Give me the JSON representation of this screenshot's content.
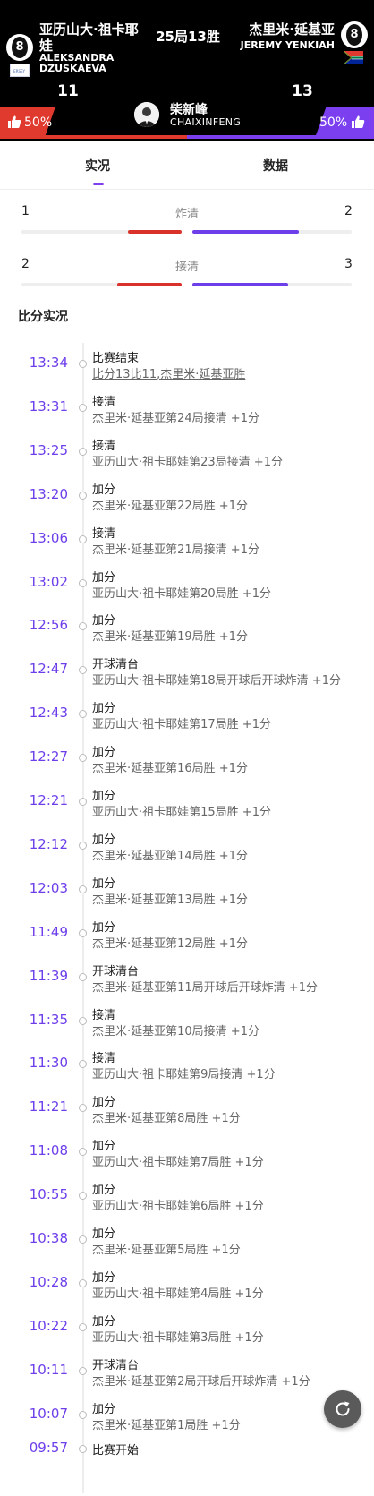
{
  "header": {
    "player_left": {
      "name_cn": "亚历山大·祖卡耶娃",
      "name_en": "ALEKSANDRA DZUSKAEVA",
      "score": "11",
      "ball_number": "8",
      "flag_text": "JERSEY"
    },
    "player_right": {
      "name_cn": "杰里米·延基亚",
      "name_en": "JEREMY YENKIAH",
      "score": "13",
      "ball_number": "8"
    },
    "result": "25局13胜",
    "support_left": "50%",
    "support_right": "50%",
    "referee": {
      "name_cn": "柴新峰",
      "name_en": "CHAIXINFENG"
    },
    "colors": {
      "left": "#e03a2f",
      "right": "#7b3ff0"
    }
  },
  "tabs": [
    {
      "label": "实况",
      "active": true
    },
    {
      "label": "数据",
      "active": false
    }
  ],
  "stats": [
    {
      "label": "炸清",
      "left": "1",
      "right": "2",
      "left_fraction": 0.333,
      "right_fraction": 0.667
    },
    {
      "label": "接清",
      "left": "2",
      "right": "3",
      "left_fraction": 0.4,
      "right_fraction": 0.6
    }
  ],
  "section_title": "比分实况",
  "events": [
    {
      "time": "13:34",
      "title": "比赛结束",
      "desc": "比分13比11,杰里米·延基亚胜"
    },
    {
      "time": "13:31",
      "title": "接清",
      "desc": "杰里米·延基亚第24局接清 +1分"
    },
    {
      "time": "13:25",
      "title": "接清",
      "desc": "亚历山大·祖卡耶娃第23局接清 +1分"
    },
    {
      "time": "13:20",
      "title": "加分",
      "desc": "杰里米·延基亚第22局胜 +1分"
    },
    {
      "time": "13:06",
      "title": "接清",
      "desc": "杰里米·延基亚第21局接清 +1分"
    },
    {
      "time": "13:02",
      "title": "加分",
      "desc": "亚历山大·祖卡耶娃第20局胜 +1分"
    },
    {
      "time": "12:56",
      "title": "加分",
      "desc": "杰里米·延基亚第19局胜 +1分"
    },
    {
      "time": "12:47",
      "title": "开球清台",
      "desc": "亚历山大·祖卡耶娃第18局开球后开球炸清 +1分"
    },
    {
      "time": "12:43",
      "title": "加分",
      "desc": "亚历山大·祖卡耶娃第17局胜 +1分"
    },
    {
      "time": "12:27",
      "title": "加分",
      "desc": "杰里米·延基亚第16局胜 +1分"
    },
    {
      "time": "12:21",
      "title": "加分",
      "desc": "亚历山大·祖卡耶娃第15局胜 +1分"
    },
    {
      "time": "12:12",
      "title": "加分",
      "desc": "杰里米·延基亚第14局胜 +1分"
    },
    {
      "time": "12:03",
      "title": "加分",
      "desc": "杰里米·延基亚第13局胜 +1分"
    },
    {
      "time": "11:49",
      "title": "加分",
      "desc": "杰里米·延基亚第12局胜 +1分"
    },
    {
      "time": "11:39",
      "title": "开球清台",
      "desc": "杰里米·延基亚第11局开球后开球炸清 +1分"
    },
    {
      "time": "11:35",
      "title": "接清",
      "desc": "杰里米·延基亚第10局接清 +1分"
    },
    {
      "time": "11:30",
      "title": "接清",
      "desc": "亚历山大·祖卡耶娃第9局接清 +1分"
    },
    {
      "time": "11:21",
      "title": "加分",
      "desc": "杰里米·延基亚第8局胜 +1分"
    },
    {
      "time": "11:08",
      "title": "加分",
      "desc": "亚历山大·祖卡耶娃第7局胜 +1分"
    },
    {
      "time": "10:55",
      "title": "加分",
      "desc": "亚历山大·祖卡耶娃第6局胜 +1分"
    },
    {
      "time": "10:38",
      "title": "加分",
      "desc": "杰里米·延基亚第5局胜 +1分"
    },
    {
      "time": "10:28",
      "title": "加分",
      "desc": "亚历山大·祖卡耶娃第4局胜 +1分"
    },
    {
      "time": "10:22",
      "title": "加分",
      "desc": "亚历山大·祖卡耶娃第3局胜 +1分"
    },
    {
      "time": "10:11",
      "title": "开球清台",
      "desc": "杰里米·延基亚第2局开球后开球炸清 +1分"
    },
    {
      "time": "10:07",
      "title": "加分",
      "desc": "杰里米·延基亚第1局胜 +1分"
    },
    {
      "time": "09:57",
      "title": "比赛开始",
      "desc": ""
    }
  ],
  "icons": {
    "refresh": "refresh-icon",
    "thumb": "thumbs-up-icon",
    "ball": "eight-ball-icon"
  }
}
